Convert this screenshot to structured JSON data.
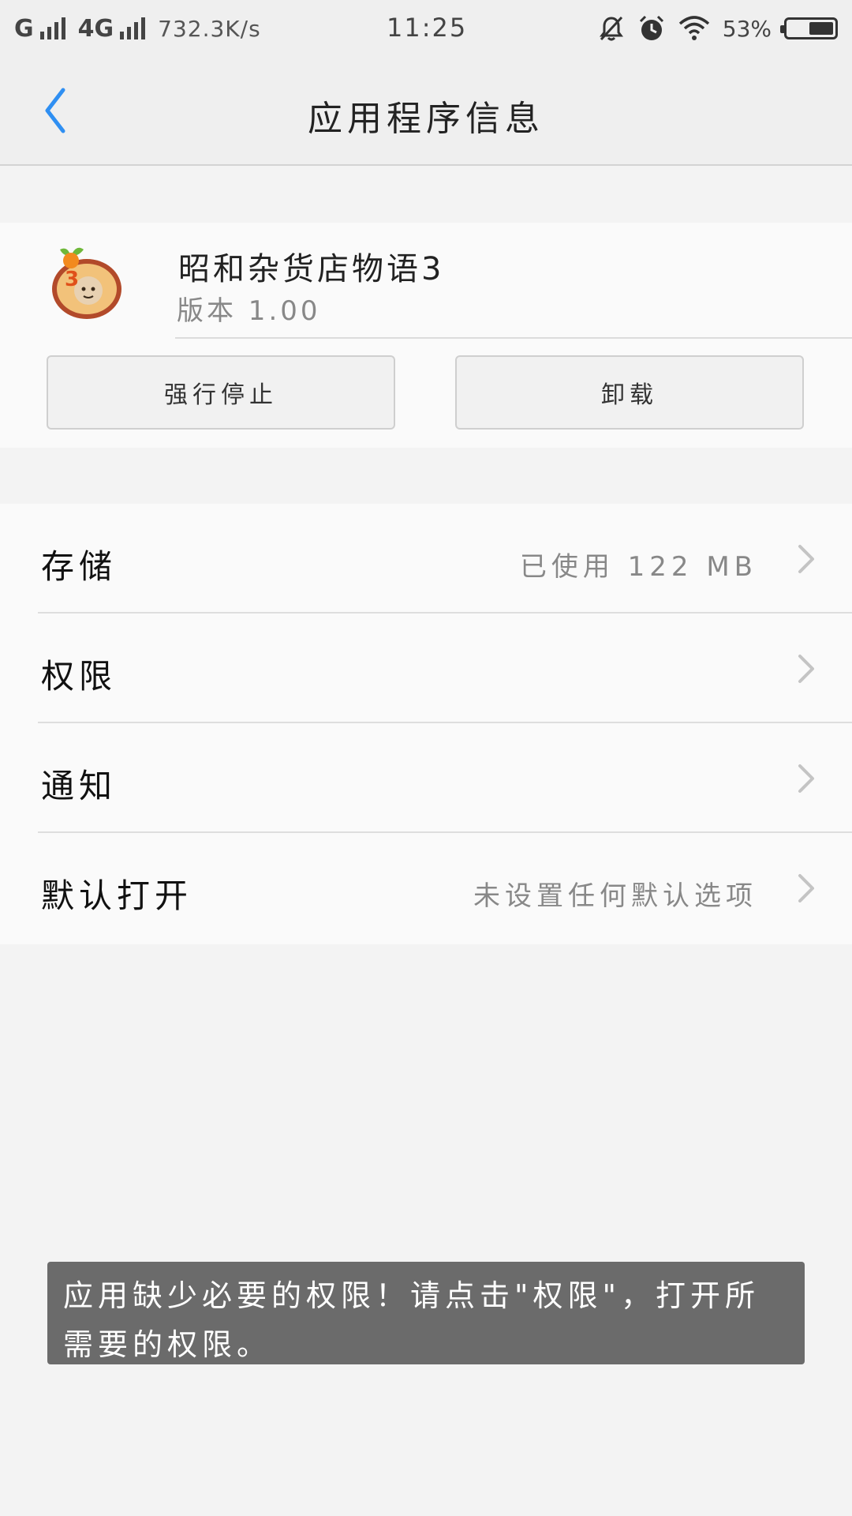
{
  "status_bar": {
    "carrier": "G",
    "network": "4G",
    "speed": "732.3K/s",
    "time": "11:25",
    "battery": "53%",
    "battery_level": 0.53,
    "icons": [
      "signal-icon",
      "mute-icon",
      "alarm-icon",
      "wifi-icon",
      "battery-icon"
    ]
  },
  "header": {
    "title": "应用程序信息",
    "back_icon": "chevron-left-icon",
    "accent_color": "#2f8ff2"
  },
  "app": {
    "name": "昭和杂货店物语3",
    "version": "版本 1.00",
    "icon": "app-icon-shop"
  },
  "buttons": {
    "force_stop": "强行停止",
    "uninstall": "卸载"
  },
  "settings": [
    {
      "label": "存储",
      "value": "已使用 122 MB"
    },
    {
      "label": "权限",
      "value": ""
    },
    {
      "label": "通知",
      "value": ""
    },
    {
      "label": "默认打开",
      "value": "未设置任何默认选项"
    }
  ],
  "toast": {
    "message": "应用缺少必要的权限！请点击\"权限\"，打开所需要的权限。"
  }
}
